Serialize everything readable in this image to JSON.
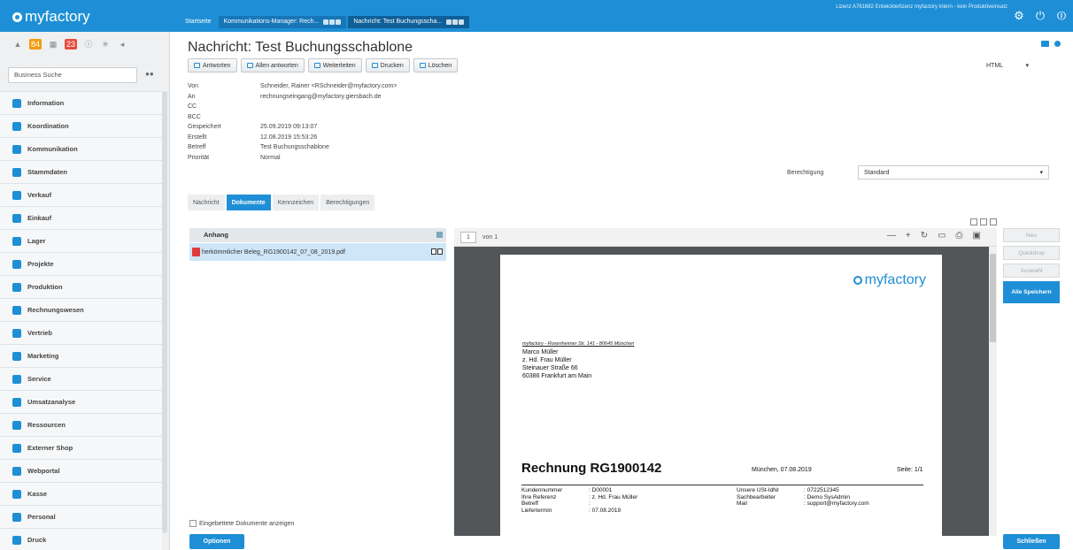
{
  "app": {
    "logo_text": "myfactory"
  },
  "topbar": {
    "tabs": [
      {
        "label": "Startseite"
      },
      {
        "label": "Kommunikations-Manager: Rech..."
      },
      {
        "label": "Nachricht: Test Buchungsscha..."
      }
    ],
    "license": "Lizenz A761682 Entwicklerlizenz myfactory Intern - kein Produktiveinsatz",
    "icons": [
      "gear-icon",
      "power-icon",
      "logout-icon"
    ]
  },
  "sidebar": {
    "search_placeholder": "Business Suche",
    "badges": [
      "84",
      "23"
    ],
    "items": [
      {
        "label": "Information",
        "icon": "info-icon"
      },
      {
        "label": "Koordination",
        "icon": "coordination-icon"
      },
      {
        "label": "Kommunikation",
        "icon": "chat-icon"
      },
      {
        "label": "Stammdaten",
        "icon": "database-icon"
      },
      {
        "label": "Verkauf",
        "icon": "coins-icon"
      },
      {
        "label": "Einkauf",
        "icon": "cart-icon"
      },
      {
        "label": "Lager",
        "icon": "warehouse-icon"
      },
      {
        "label": "Projekte",
        "icon": "monitor-icon"
      },
      {
        "label": "Produktion",
        "icon": "factory-icon"
      },
      {
        "label": "Rechnungswesen",
        "icon": "grid-icon"
      },
      {
        "label": "Vertrieb",
        "icon": "sales-icon"
      },
      {
        "label": "Marketing",
        "icon": "marketing-icon"
      },
      {
        "label": "Service",
        "icon": "service-icon"
      },
      {
        "label": "Umsatzanalyse",
        "icon": "bar-chart-icon"
      },
      {
        "label": "Ressourcen",
        "icon": "resources-icon"
      },
      {
        "label": "Externer Shop",
        "icon": "shop-icon"
      },
      {
        "label": "Webportal",
        "icon": "webportal-icon"
      },
      {
        "label": "Kasse",
        "icon": "register-icon"
      },
      {
        "label": "Personal",
        "icon": "people-icon"
      },
      {
        "label": "Druck",
        "icon": "print-icon"
      }
    ]
  },
  "message": {
    "title": "Nachricht: Test Buchungsschablone",
    "toolbar": {
      "reply": "Antworten",
      "reply_all": "Allen antworten",
      "forward": "Weiterleiten",
      "print": "Drucken",
      "delete": "Löschen"
    },
    "format": "HTML",
    "fields": [
      {
        "key": "Von",
        "value": "Schneider, Rainer <RSchneider@myfactory.com>"
      },
      {
        "key": "An",
        "value": "rechnungseingang@myfactory.giersbach.de"
      },
      {
        "key": "CC",
        "value": ""
      },
      {
        "key": "BCC",
        "value": ""
      },
      {
        "key": "Gespeichert",
        "value": "25.09.2019 09:13:07"
      },
      {
        "key": "Erstellt",
        "value": "12.08.2019 15:53:26"
      },
      {
        "key": "Betreff",
        "value": "Test Buchungsschablone"
      },
      {
        "key": "Priorität",
        "value": "Normal"
      }
    ],
    "permission_label": "Berechtigung",
    "permission_value": "Standard",
    "tabs": [
      {
        "label": "Nachricht"
      },
      {
        "label": "Dokumente"
      },
      {
        "label": "Kennzeichen"
      },
      {
        "label": "Berechtigungen"
      }
    ],
    "attachments_header": "Anhang",
    "attachment": "herkömmlicher Beleg_RG1900142_07_08_2019.pdf"
  },
  "viewer": {
    "page": "1",
    "of": "von 1",
    "pdf": {
      "logo": "myfactory",
      "sender": "myfactory - Rosenheimer Str. 141 - 80645 München",
      "address": [
        "Marco Müller",
        "z. Hd. Frau Müller",
        "Steinauer Straße 66",
        "60386 Frankfurt am Main"
      ],
      "title": "Rechnung RG1900142",
      "place_date": "München, 07.08.2019",
      "page_info": "Seite: 1/1",
      "details": [
        [
          "Kundennummer",
          ": D00001",
          "Unsere USt-IdNr",
          ": 0722512345"
        ],
        [
          "Ihre Referenz",
          ": z. Hd. Frau Müller",
          "Sachbearbeiter",
          ": Demo SysAdmin"
        ],
        [
          "Betreff",
          ":",
          "Mail",
          ": support@myfactory.com"
        ],
        [
          "Liefertermin",
          ": 07.08.2019",
          "",
          ""
        ]
      ]
    }
  },
  "actions": {
    "neu": "Neu",
    "quickdrop": "Quickdrop",
    "auswahl": "Auswahl",
    "alle_speichern": "Alle Speichern",
    "embed_label": "Eingebettete Dokumente anzeigen",
    "optionen": "Optionen",
    "schliessen": "Schließen"
  }
}
